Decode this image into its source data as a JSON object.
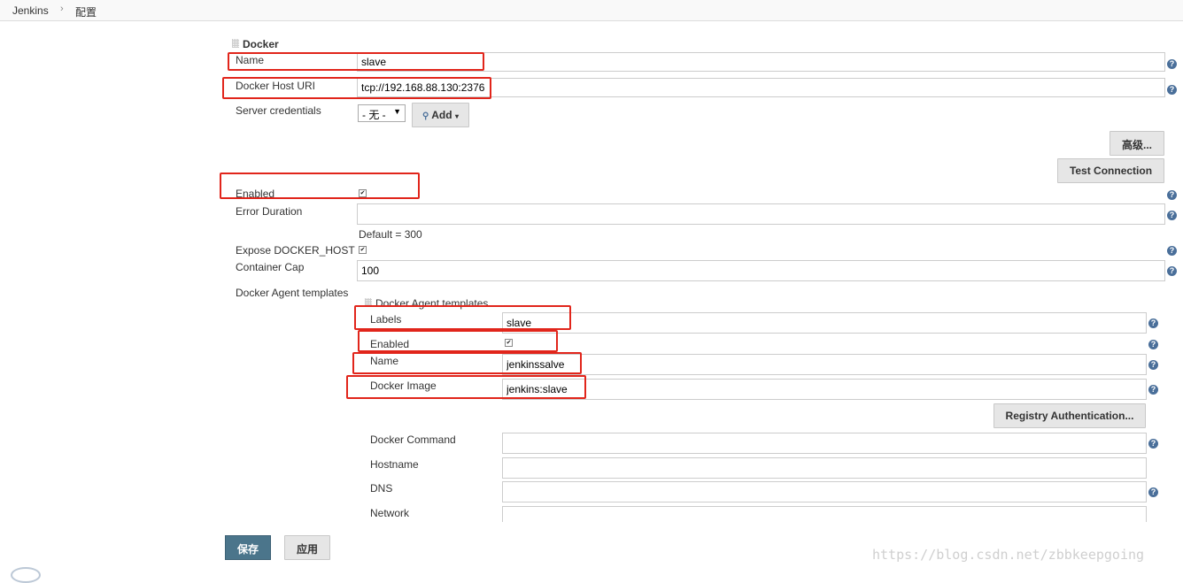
{
  "breadcrumb": {
    "root": "Jenkins",
    "separator": "›",
    "current": "配置"
  },
  "docker": {
    "section_title": "Docker",
    "name_label": "Name",
    "name_value": "slave",
    "host_uri_label": "Docker Host URI",
    "host_uri_value": "tcp://192.168.88.130:2376",
    "credentials_label": "Server credentials",
    "credentials_value": "- 无 -",
    "add_button": "Add",
    "advanced_button": "高级...",
    "test_connection_button": "Test Connection",
    "enabled_label": "Enabled",
    "error_duration_label": "Error Duration",
    "error_duration_value": "",
    "error_duration_hint": "Default = 300",
    "expose_label": "Expose DOCKER_HOST",
    "container_cap_label": "Container Cap",
    "container_cap_value": "100",
    "templates_label": "Docker Agent templates"
  },
  "template": {
    "section_title": "Docker Agent templates",
    "labels_label": "Labels",
    "labels_value": "slave",
    "enabled_label": "Enabled",
    "name_label": "Name",
    "name_value": "jenkinssalve",
    "image_label": "Docker Image",
    "image_value": "jenkins:slave",
    "registry_button": "Registry Authentication...",
    "command_label": "Docker Command",
    "hostname_label": "Hostname",
    "dns_label": "DNS",
    "network_label": "Network"
  },
  "footer": {
    "save_button": "保存",
    "apply_button": "应用"
  },
  "watermark": "https://blog.csdn.net/zbbkeepgoing",
  "colors": {
    "accent": "#4b758b",
    "highlight": "#e1251b",
    "help_icon": "#4a6f9a"
  }
}
